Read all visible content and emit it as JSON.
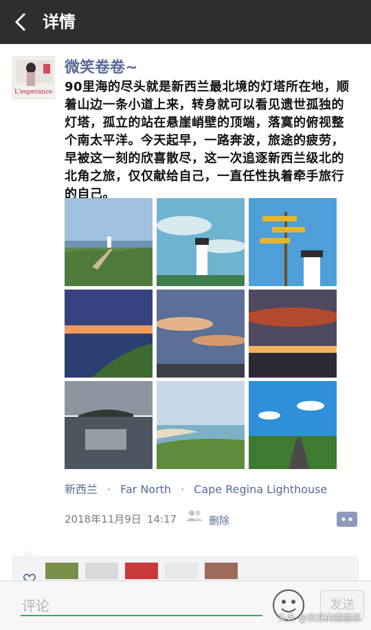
{
  "header": {
    "title": "详情"
  },
  "post": {
    "author": "微笑卷卷~",
    "avatar_brand": "L'esperance",
    "text": "90里海的尽头就是新西兰最北境的灯塔所在地，顺着山边一条小道上来，转身就可以看见遗世孤独的灯塔，孤立的站在悬崖峭壁的顶端，落寞的俯视整个南太平洋。今天起早，一路奔波，旅途的疲劳，早被这一刻的欣喜散尽，这一次追逐新西兰级北的北角之旅，仅仅献给自己，一直任性执着牵手旅行的自己。",
    "location": {
      "country": "新西兰",
      "region": "Far North",
      "place": "Cape Regina Lighthouse",
      "separator": "·"
    },
    "date": "2018年11月9日",
    "time": "14:17",
    "delete_label": "删除",
    "photo_count": 9
  },
  "composer": {
    "placeholder": "评论",
    "send_label": "发送"
  },
  "watermark": "头条 @愤怒的圆圆熊",
  "colors": {
    "titlebar": "#2e2e2e",
    "link": "#576b95",
    "input_underline": "#2aae67"
  },
  "icons": [
    "back-arrow-icon",
    "privacy-icon",
    "comment-icon",
    "heart-icon",
    "emoji-icon"
  ]
}
